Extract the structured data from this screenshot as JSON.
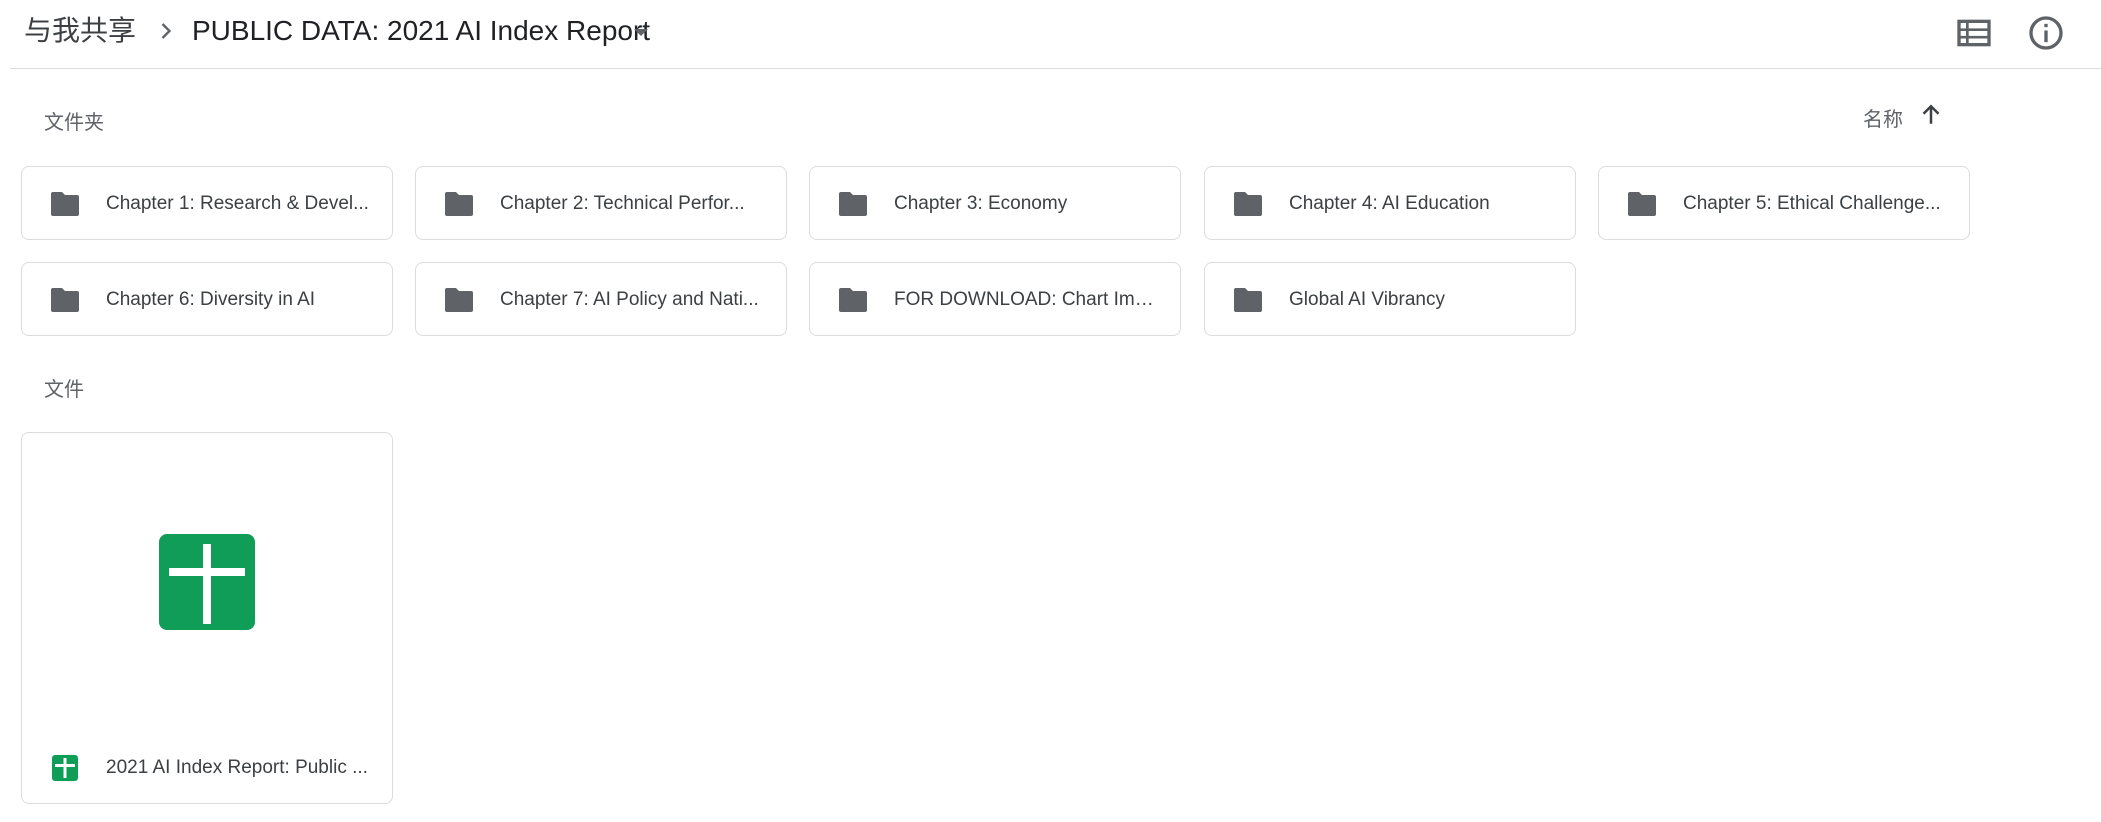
{
  "breadcrumb": {
    "root": "与我共享",
    "current": "PUBLIC DATA: 2021 AI Index Report"
  },
  "toolbar": {
    "list_view_icon": "list-view-icon",
    "info_icon": "info-icon"
  },
  "sections": {
    "folders_label": "文件夹",
    "files_label": "文件"
  },
  "sort": {
    "label": "名称",
    "direction": "ascending",
    "icon": "arrow-up-icon"
  },
  "folders": [
    {
      "name": "Chapter 1: Research & Devel..."
    },
    {
      "name": "Chapter 2: Technical Perfor..."
    },
    {
      "name": "Chapter 3: Economy"
    },
    {
      "name": "Chapter 4: AI Education"
    },
    {
      "name": "Chapter 5: Ethical Challenge..."
    },
    {
      "name": "Chapter 6: Diversity in AI"
    },
    {
      "name": "Chapter 7: AI Policy and Nati..."
    },
    {
      "name": "FOR DOWNLOAD: Chart Imag..."
    },
    {
      "name": "Global AI Vibrancy"
    }
  ],
  "files": [
    {
      "name": "2021 AI Index Report: Public ...",
      "type": "google-sheets",
      "icon": "sheets-icon"
    }
  ],
  "colors": {
    "folder_icon": "#5f6368",
    "sheets_green": "#0f9d58",
    "border": "#dadce0",
    "text": "#3c4043"
  }
}
